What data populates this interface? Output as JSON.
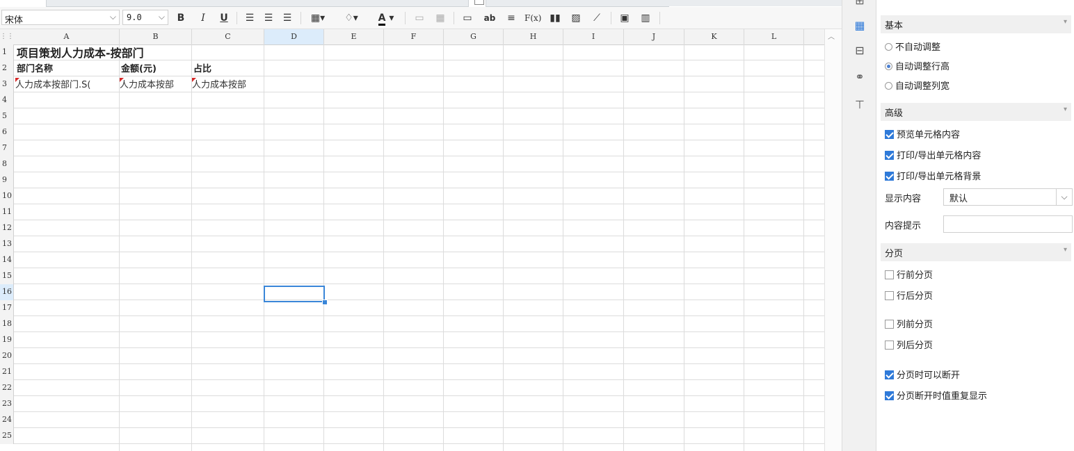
{
  "toolbar": {
    "font_family": "宋体",
    "font_size": "9.0",
    "bold": "B",
    "italic": "I",
    "underline": "U",
    "font_color_letter": "A",
    "text_wrap": "ab",
    "formula": "F(x)"
  },
  "columns": [
    "A",
    "B",
    "C",
    "D",
    "E",
    "F",
    "G",
    "H",
    "I",
    "J",
    "K",
    "L"
  ],
  "selected_column": "D",
  "selected_row": "16",
  "rows": [
    "1",
    "2",
    "3",
    "4",
    "5",
    "6",
    "7",
    "8",
    "9",
    "10",
    "11",
    "12",
    "13",
    "14",
    "15",
    "16",
    "17",
    "18",
    "19",
    "20",
    "21",
    "22",
    "23",
    "24",
    "25"
  ],
  "cells": {
    "title": "项目策划人力成本-按部门",
    "header_dept": "部门名称",
    "header_amount": "金额(元)",
    "header_ratio": "占比",
    "val_dept": "人力成本按部门.S(",
    "val_amount": "人力成本按部",
    "val_ratio": "人力成本按部"
  },
  "panel": {
    "basic": {
      "title": "基本",
      "options": [
        {
          "label": "不自动调整",
          "selected": false
        },
        {
          "label": "自动调整行高",
          "selected": true
        },
        {
          "label": "自动调整列宽",
          "selected": false
        }
      ]
    },
    "advanced": {
      "title": "高级",
      "preview_label": "预览单元格内容",
      "print_content_label": "打印/导出单元格内容",
      "print_bg_label": "打印/导出单元格背景",
      "display_label": "显示内容",
      "display_value": "默认",
      "tooltip_label": "内容提示",
      "tooltip_value": ""
    },
    "paging": {
      "title": "分页",
      "row_before": "行前分页",
      "row_after": "行后分页",
      "col_before": "列前分页",
      "col_after": "列后分页",
      "can_break": "分页时可以断开",
      "repeat_on_break": "分页断开时值重复显示"
    }
  },
  "colors": {
    "accent": "#2f7ad9",
    "selected_header": "#dcecfb",
    "cell_marker": "#d62b2b"
  }
}
